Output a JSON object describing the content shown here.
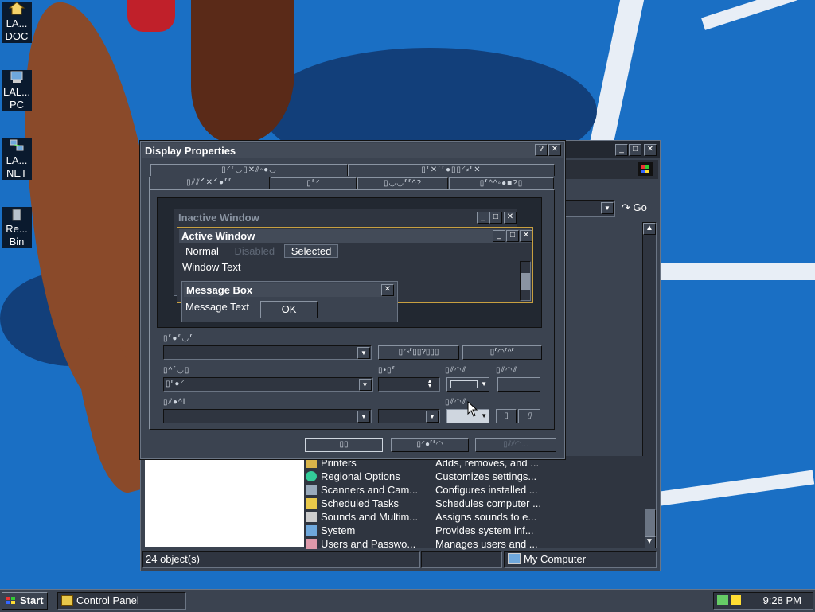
{
  "desktop": {
    "icons": [
      {
        "icon": "folder-home-icon",
        "line1": "LA...",
        "line2": "DOC"
      },
      {
        "icon": "computer-icon",
        "line1": "LAL...",
        "line2": "PC"
      },
      {
        "icon": "network-icon",
        "line1": "LA...",
        "line2": "NET"
      },
      {
        "icon": "recycle-bin-icon",
        "line1": "Re...",
        "line2": "Bin"
      }
    ]
  },
  "control_panel": {
    "go_label": "Go",
    "status_objects": "24 object(s)",
    "status_location": "My Computer",
    "items": [
      {
        "name": "Printers",
        "desc": "Adds, removes, and ..."
      },
      {
        "name": "Regional Options",
        "desc": "Customizes settings..."
      },
      {
        "name": "Scanners and Cam...",
        "desc": "Configures installed ..."
      },
      {
        "name": "Scheduled Tasks",
        "desc": "Schedules computer ..."
      },
      {
        "name": "Sounds and Multim...",
        "desc": "Assigns sounds to e..."
      },
      {
        "name": "System",
        "desc": "Provides system inf..."
      },
      {
        "name": "Users and Passwo...",
        "desc": "Manages users and ..."
      }
    ]
  },
  "dialog": {
    "title": "Display Properties",
    "help_glyph": "?",
    "close_glyph": "✕",
    "tabs_row1": [
      "▯⸍⸢◡▯✕⫽◦●◡",
      "▯⸢✕⸢⸢●▯▯⸍⸗⸢✕"
    ],
    "tabs_row2": [
      "▯⫽⫽⸍✕⸍●⸢⸢",
      "▯⸢⸍",
      "▯◡◡⸢⸢^?",
      "▯⸢^^◦●■?▯"
    ],
    "preview": {
      "inactive_title": "Inactive Window",
      "active_title": "Active Window",
      "menu_normal": "Normal",
      "menu_disabled": "Disabled",
      "menu_selected": "Selected",
      "window_text": "Window Text",
      "msgbox_title": "Message Box",
      "msgbox_text": "Message Text",
      "ok_label": "OK"
    },
    "scheme_label": "▯⸢●⸢◡⸢",
    "save_as_label": "▯⸍⸗⸢▯▯?▯▯▯",
    "delete_label": "▯⸢◠⸢^⸢",
    "item_label": "▯^⸢◡▯",
    "item_value": "▯⸢●⸍",
    "size_label": "▯•▯⸢",
    "color_label": "▯⫽◠⫽",
    "color2_label": "▯⫽◠⫽",
    "font_label": "▯⫽●^ǀ",
    "font_size_label": "",
    "font_color_label": "▯⫽◠⫽",
    "bold_label": "▯",
    "italic_label": "▯",
    "ok_button": "▯▯",
    "cancel_button": "▯⸍●⸢⸢◠",
    "apply_button": "▯⫽⫽◠..."
  },
  "taskbar": {
    "start_label": "Start",
    "task_label": "Control Panel",
    "clock": "9:28 PM"
  }
}
